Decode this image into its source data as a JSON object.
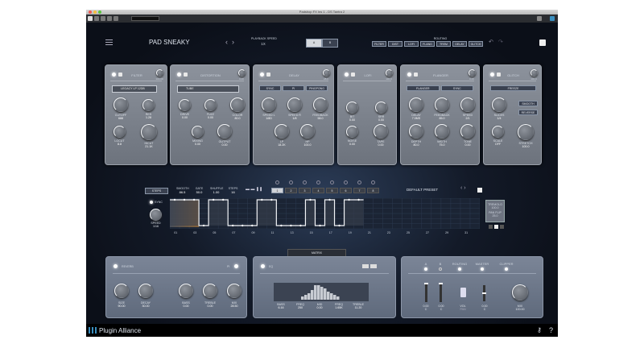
{
  "window": {
    "title": "Padshop FX Ins 1 - DS Tantra 2"
  },
  "header": {
    "preset_name": "PAD SNEAKY",
    "playback_speed_label": "PLAYBACK SPEED",
    "playback_speed_value": "1X",
    "ab": [
      "A",
      "B"
    ],
    "routing_label": "ROUTING",
    "routing": [
      "FILTER",
      "DIST",
      "LOFI",
      "FLANG",
      "TREM",
      "DELAY",
      "GLITCH"
    ]
  },
  "modules": [
    {
      "id": "filter",
      "title": "FILTER",
      "mix": "100.00",
      "select": "LEGACY LP 12DB",
      "buttons": [],
      "knobs": [
        {
          "label": "CUTOFF",
          "value": "688"
        },
        {
          "label": "RES",
          "value": "1.28"
        },
        {
          "label": "LOCUT",
          "value": "8.8"
        },
        {
          "label": "HICUT",
          "value": "21.1K"
        }
      ]
    },
    {
      "id": "distortion",
      "title": "DISTORTION",
      "mix": "0.00",
      "select": "TUBE",
      "buttons": [],
      "knobs": [
        {
          "label": "DRIVE",
          "value": "0.00"
        },
        {
          "label": "FUZZ",
          "value": "0.00"
        },
        {
          "label": "COLOR",
          "value": "80.0"
        },
        {
          "label": "MIXING",
          "value": "0.00"
        },
        {
          "label": "OUTPUT",
          "value": "0.00"
        }
      ]
    },
    {
      "id": "delay",
      "title": "DELAY",
      "mix": "28.0",
      "select": null,
      "buttons": [
        "SYNC",
        "PI",
        "PINGPONG"
      ],
      "knobs": [
        {
          "label": "SPEED L",
          "value": "1/8D"
        },
        {
          "label": "SPEED R",
          "value": "1/8"
        },
        {
          "label": "FEEDBACK",
          "value": "58.0"
        },
        {
          "label": "LP",
          "value": "18.2K"
        },
        {
          "label": "HP",
          "value": "100.0"
        }
      ]
    },
    {
      "id": "lofi",
      "title": "LOFI",
      "mix": "100.0",
      "select": null,
      "buttons": [],
      "knobs": [
        {
          "label": "BIT",
          "value": "0.00"
        },
        {
          "label": "SRR",
          "value": "0.00"
        },
        {
          "label": "NOISE",
          "value": "0.00"
        },
        {
          "label": "TAPE",
          "value": "0.00"
        }
      ]
    },
    {
      "id": "flanger",
      "title": "FLANGER",
      "mix": "0.00",
      "select": null,
      "buttons": [
        "FLANGER",
        "SYNC"
      ],
      "knobs": [
        {
          "label": "DELAY",
          "value": "7.0MS"
        },
        {
          "label": "FEEDBACK",
          "value": "85.0"
        },
        {
          "label": "SPEED",
          "value": "2/1"
        },
        {
          "label": "DEPTH",
          "value": "80.0"
        },
        {
          "label": "WIDTH",
          "value": "75.0"
        },
        {
          "label": "TONE",
          "value": "0.00"
        }
      ]
    },
    {
      "id": "glitch",
      "title": "GLITCH",
      "mix": "100.0",
      "select": null,
      "buttons": [
        "FREEZE",
        "SMOOTH",
        "REVERSE"
      ],
      "knobs": [
        {
          "label": "SLICES",
          "value": "1/4"
        },
        {
          "label": "SCALE",
          "value": "OFF"
        },
        {
          "label": "STRETCH",
          "value": "100.0"
        }
      ]
    }
  ],
  "sequencer": {
    "mode": "STEPS",
    "params": [
      {
        "label": "SMOOTH",
        "value": "86.5"
      },
      {
        "label": "GATE",
        "value": "50.0"
      },
      {
        "label": "SHUFFLE",
        "value": "1.00"
      },
      {
        "label": "STEPS",
        "value": "16"
      }
    ],
    "slots": [
      "1",
      "2",
      "3",
      "4",
      "5",
      "6",
      "7",
      "8"
    ],
    "active_slot": "1",
    "preset": "DEFAULT PRESET",
    "sync_label": "SYNC",
    "speed_label": "SPEED",
    "speed_value": "1/16",
    "tremolo_label": "TREMOLO",
    "tremolo_value": "100.0",
    "panflip_label": "PAN FLIP",
    "panflip_value": "25.0",
    "step_numbers": [
      "01",
      "03",
      "05",
      "07",
      "09",
      "11",
      "13",
      "15",
      "17",
      "19",
      "21",
      "23",
      "25",
      "27",
      "29",
      "31"
    ],
    "steps": [
      1,
      1,
      1,
      0,
      1,
      1,
      0,
      0,
      0,
      1,
      1,
      0,
      0,
      0,
      1,
      0,
      1,
      0,
      1,
      1
    ]
  },
  "matrix_tab": "MATRIX",
  "reverb": {
    "title": "REVERB",
    "pi": "PI",
    "knobs": [
      {
        "label": "SIZE",
        "value": "90.00"
      },
      {
        "label": "DECAY",
        "value": "30.00"
      },
      {
        "label": "BASS",
        "value": "0.00"
      },
      {
        "label": "TREBLE",
        "value": "0.00"
      },
      {
        "label": "MIX",
        "value": "28.50"
      }
    ]
  },
  "eq": {
    "title": "EQ",
    "knobs": [
      {
        "label": "BASS",
        "value": "6.16"
      },
      {
        "label": "FREQ",
        "value": "250"
      },
      {
        "label": "MID",
        "value": "0.00"
      },
      {
        "label": "FREQ",
        "value": "1.65K"
      },
      {
        "label": "TREBLE",
        "value": "11.20"
      }
    ]
  },
  "mixer": {
    "labels": [
      "A",
      "B",
      "ROUTING",
      "MASTER",
      "CLIPPER"
    ],
    "fader_a": [
      "0.00",
      "C"
    ],
    "fader_b": [
      "0.00",
      "C"
    ],
    "volpan": [
      "VOL",
      "PAN"
    ],
    "master": [
      "0.00",
      "C"
    ],
    "mix_label": "MIX",
    "mix_value": "100.00"
  },
  "footer": {
    "brand": "Plugin Alliance",
    "help": "?"
  },
  "colors": {
    "accent": "#3a8fc0",
    "panel": "#7a808a"
  }
}
